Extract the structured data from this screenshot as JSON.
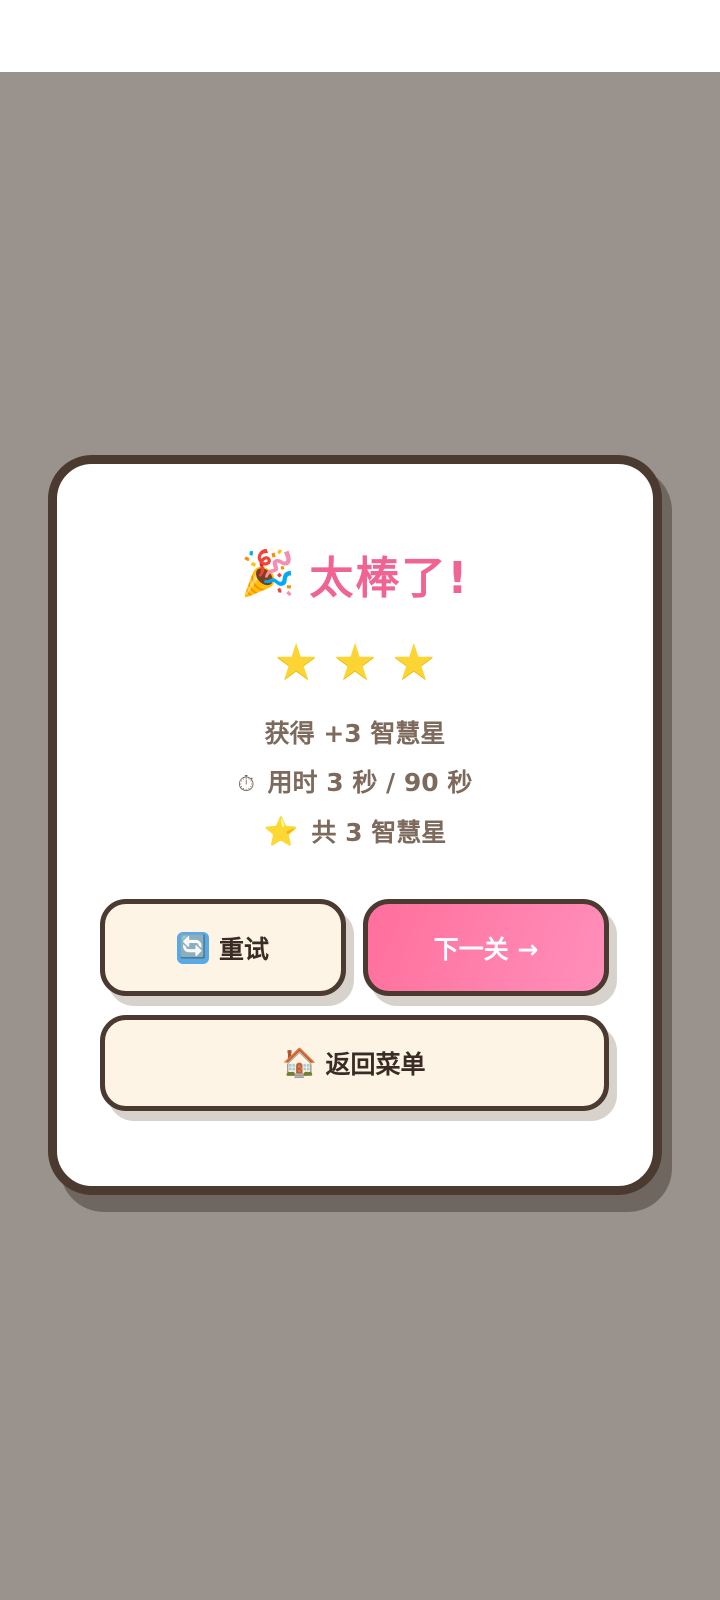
{
  "dialog": {
    "title_icon": "🎉",
    "title": "太棒了!",
    "stars": [
      "★",
      "★",
      "★"
    ],
    "reward_text": "获得 +3 智慧星",
    "time_icon": "⏱",
    "time_text": "用时 3 秒 / 90 秒",
    "total_icon": "⭐",
    "total_text": "共 3 智慧星"
  },
  "buttons": {
    "retry_icon": "🔄",
    "retry_label": "重试",
    "next_label": "下一关 →",
    "menu_icon": "🏠",
    "menu_label": "返回菜单"
  },
  "colors": {
    "overlay": "#9a928c",
    "title_pink": "#f06494",
    "star_yellow": "#fcd535",
    "border_brown": "#4a3a30",
    "next_button_gradient_start": "#ff6f9c",
    "next_button_gradient_end": "#ff8fba",
    "cream_button": "#fdf4e6"
  }
}
